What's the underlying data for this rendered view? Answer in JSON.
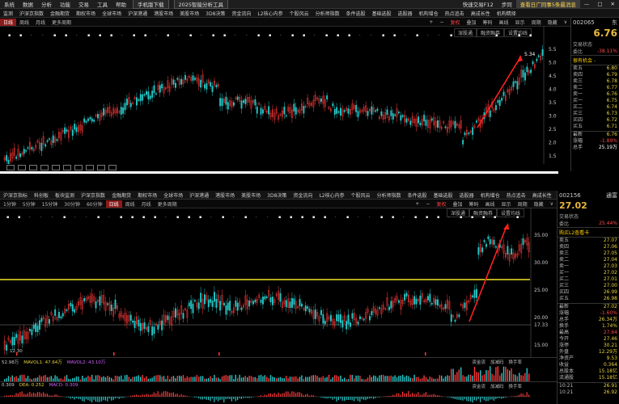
{
  "menubar": {
    "items": [
      "系统",
      "数据",
      "分析",
      "功能",
      "交易",
      "工具",
      "帮助"
    ],
    "mobile_btn": "手机版下载",
    "tool_btn": "2025智能分析工具",
    "quick_trade": "快速交易F12",
    "sync_label": "步同",
    "news_ticker": "查看日广同事5条最消息"
  },
  "top": {
    "navbar": [
      "监测",
      "沪深京指数",
      "金融期货",
      "期权市场",
      "全球市场",
      "沪深港通",
      "港股市场",
      "美股市场",
      "3D8决策",
      "资金流向",
      "L2核心内参",
      "个股风云",
      "分析师指数",
      "条件选股",
      "基础选股",
      "选股器",
      "机构增仓",
      "热点追击",
      "高成长性",
      "机构精择"
    ],
    "subbar_left": [
      "日线",
      "周线",
      "月线",
      "更多周期"
    ],
    "subbar_right": [
      "复权",
      "叠加",
      "筹码",
      "画线",
      "显示",
      "周期",
      "隐藏"
    ],
    "subbar_symbols": [
      "+",
      "−",
      "∨"
    ],
    "chart_tabs": [
      "深股通",
      "融资融券",
      "设置均线"
    ],
    "peak_label": "5.34",
    "y_ticks": [
      "5.5",
      "5.0",
      "4.5",
      "4.0",
      "3.5",
      "3.0",
      "2.5",
      "2.0",
      "1.5"
    ],
    "panel": {
      "code": "002065",
      "name_char": "东",
      "price": "6.76",
      "state_label": "交易状态",
      "change_label": "委比",
      "change_value": "-38.11%",
      "tag": "很有机会 -",
      "quotes": [
        {
          "k": "卖五",
          "v": "6.80"
        },
        {
          "k": "卖四",
          "v": "6.79"
        },
        {
          "k": "卖三",
          "v": "6.78"
        },
        {
          "k": "卖二",
          "v": "6.77"
        },
        {
          "k": "卖一",
          "v": "6.76"
        },
        {
          "k": "买一",
          "v": "6.75"
        },
        {
          "k": "买二",
          "v": "6.74"
        },
        {
          "k": "买三",
          "v": "6.73"
        },
        {
          "k": "买四",
          "v": "6.72"
        },
        {
          "k": "买五",
          "v": "6.71"
        }
      ],
      "latest_label": "最新",
      "latest_value": "6.76",
      "chg_label": "涨幅",
      "chg_value": "-1.89%",
      "turnover_label": "总手",
      "turnover_value": "25.19万"
    }
  },
  "bottom": {
    "navbar": [
      "沪深京指标",
      "科创板",
      "板块监测",
      "沪深京指数",
      "金融期货",
      "期权市场",
      "全球市场",
      "沪深港通",
      "港股市场",
      "美股市场",
      "3D8决策",
      "资金流向",
      "L2核心内参",
      "个股风云",
      "分析师指数",
      "条件选股",
      "基础选股",
      "选股器",
      "机构增仓",
      "热点追击",
      "高成长性",
      "机构精择"
    ],
    "subbar_left": [
      "1分钟",
      "5分钟",
      "15分钟",
      "30分钟",
      "60分钟",
      "日线",
      "周线",
      "月线",
      "更多周期"
    ],
    "subbar_right": [
      "复权",
      "叠加",
      "筹码",
      "画线",
      "显示",
      "周期",
      "隐藏"
    ],
    "subbar_symbols": [
      "+",
      "−",
      "∨"
    ],
    "chart_tabs": [
      "深股通",
      "融资融券",
      "设置均线"
    ],
    "y_ticks": [
      "35.00",
      "30.00",
      "25.00",
      "20.00",
      "15.00"
    ],
    "price_marker": "17.33",
    "low_label": "12.30",
    "vol_legend": {
      "a": "52.98万",
      "b": "MAVOL1: 47.64万",
      "c": "MAVOL2: 43.10万"
    },
    "vol_tabs": [
      "资金流",
      "加减码",
      "换手率"
    ],
    "macd_legend": {
      "a": "0.309",
      "b": "DEA: 0.252",
      "c": "MACD: 0.309"
    },
    "macd_tabs": [
      "资金流",
      "加减码",
      "换手率"
    ],
    "panel": {
      "code": "002156",
      "name": "通富",
      "price": "27.02",
      "state_label": "交易状态",
      "change_label": "委比",
      "change_value": "25.44%",
      "tag": "购买L2查看卡",
      "quotes": [
        {
          "k": "卖五",
          "v": "27.07"
        },
        {
          "k": "卖四",
          "v": "27.06"
        },
        {
          "k": "卖三",
          "v": "27.05"
        },
        {
          "k": "卖二",
          "v": "27.04"
        },
        {
          "k": "卖一",
          "v": "27.03"
        },
        {
          "k": "买一",
          "v": "27.02"
        },
        {
          "k": "买二",
          "v": "27.01"
        },
        {
          "k": "买三",
          "v": "27.00"
        },
        {
          "k": "买四",
          "v": "26.99"
        },
        {
          "k": "买五",
          "v": "26.98"
        }
      ],
      "stats": [
        {
          "k": "最新",
          "v": "27.02"
        },
        {
          "k": "涨幅",
          "v": "-1.60%"
        },
        {
          "k": "总手",
          "v": "26.34万"
        },
        {
          "k": "换手",
          "v": "1.74%"
        },
        {
          "k": "最高",
          "v": "27.64"
        },
        {
          "k": "今开",
          "v": "27.46"
        },
        {
          "k": "涨停",
          "v": "30.21"
        },
        {
          "k": "外盘",
          "v": "12.29万"
        },
        {
          "k": "净资产",
          "v": "9.53"
        },
        {
          "k": "收益",
          "v": "0.364"
        },
        {
          "k": "总股本",
          "v": "15.18亿"
        },
        {
          "k": "流通股",
          "v": "15.18亿"
        }
      ],
      "time_rows": [
        {
          "t": "10:21",
          "v": "26.91"
        },
        {
          "t": "10:21",
          "v": "26.92"
        }
      ]
    }
  },
  "colors": {
    "up": "#ff3a3a",
    "down": "#27c8c8",
    "arrow": "#ff2020",
    "hline": "#f3e32a",
    "accent": "#e8b83c"
  }
}
